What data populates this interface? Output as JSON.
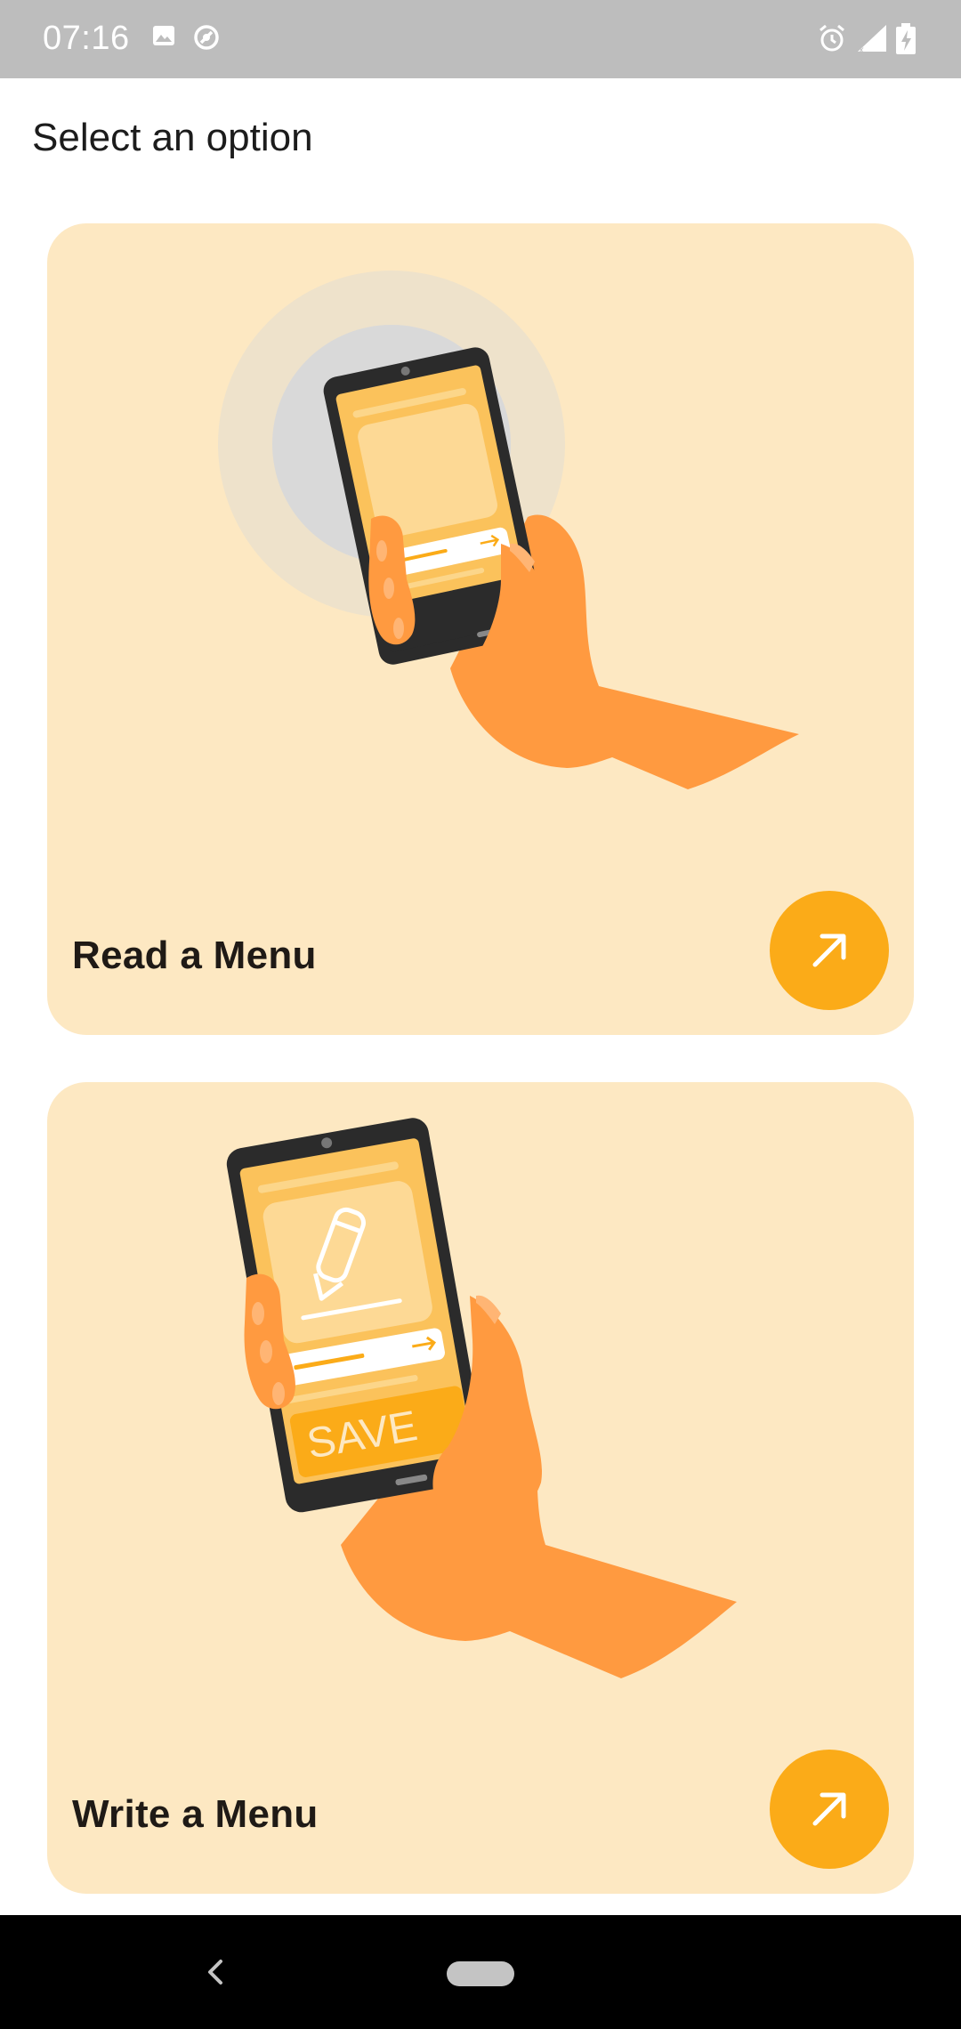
{
  "status_bar": {
    "time": "07:16",
    "icons": [
      "image-icon",
      "sync-icon",
      "alarm-icon",
      "signal-icon",
      "battery-charging-icon"
    ]
  },
  "page": {
    "title": "Select an option"
  },
  "cards": [
    {
      "label": "Read a Menu",
      "action_icon": "arrow-up-right-icon",
      "illustration": "hand-holding-phone"
    },
    {
      "label": "Write a Menu",
      "action_icon": "arrow-up-right-icon",
      "illustration": "hand-holding-phone-save",
      "illustration_text": "SAVE"
    }
  ],
  "nav_bar": {
    "icons": [
      "back-icon",
      "home-pill-icon"
    ]
  },
  "colors": {
    "status_bar": "#bdbdbd",
    "card_background": "#fde8c2",
    "accent": "#fbab18",
    "hand": "#ff9a40",
    "nav_bar": "#000000"
  }
}
